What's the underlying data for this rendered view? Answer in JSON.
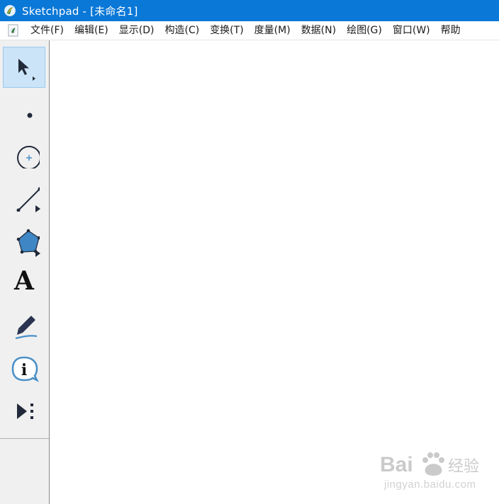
{
  "window": {
    "title": "Sketchpad  - [未命名1]"
  },
  "menubar": {
    "items": [
      {
        "label": "文件(F)"
      },
      {
        "label": "编辑(E)"
      },
      {
        "label": "显示(D)"
      },
      {
        "label": "构造(C)"
      },
      {
        "label": "变换(T)"
      },
      {
        "label": "度量(M)"
      },
      {
        "label": "数据(N)"
      },
      {
        "label": "绘图(G)"
      },
      {
        "label": "窗口(W)"
      },
      {
        "label": "帮助"
      }
    ]
  },
  "toolbox": {
    "tools": [
      {
        "name": "selection-arrow-tool",
        "icon": "arrow-pointer-icon",
        "active": true
      },
      {
        "name": "point-tool",
        "icon": "point-icon"
      },
      {
        "name": "compass-tool",
        "icon": "circle-icon"
      },
      {
        "name": "straightedge-tool",
        "icon": "segment-icon"
      },
      {
        "name": "polygon-tool",
        "icon": "polygon-icon"
      },
      {
        "name": "text-tool",
        "icon": "letter-a-icon",
        "glyph": "A"
      },
      {
        "name": "marker-tool",
        "icon": "marker-pen-icon"
      },
      {
        "name": "information-tool",
        "icon": "info-icon",
        "glyph": "i"
      },
      {
        "name": "custom-tool",
        "icon": "play-more-icon"
      }
    ]
  },
  "watermark": {
    "brand": "Bai",
    "brand_cn": "经验",
    "domain": "jingyan.baidu.com"
  },
  "colors": {
    "titlebar": "#0a78d7",
    "tool_active": "#cce4f7",
    "accent_blue": "#4a90c8"
  }
}
